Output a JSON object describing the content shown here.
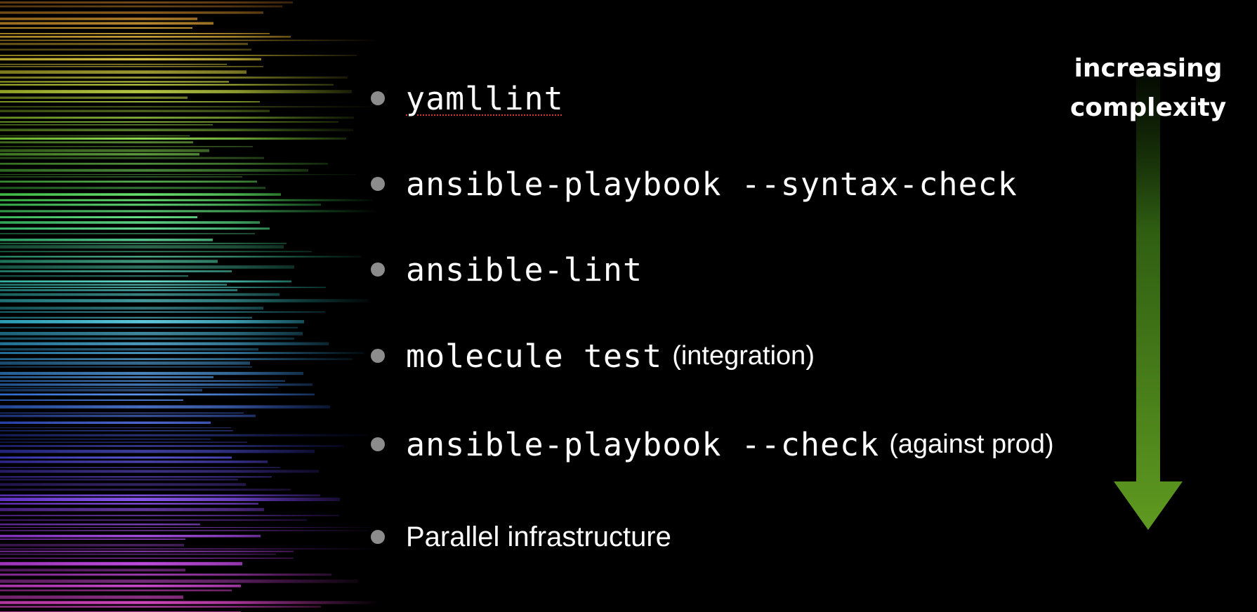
{
  "slide": {
    "background": "#000000",
    "items": [
      {
        "code": "yamllint",
        "note": ""
      },
      {
        "code": "ansible-playbook --syntax-check",
        "note": ""
      },
      {
        "code": "ansible-lint",
        "note": ""
      },
      {
        "code": "molecule test",
        "note": "(integration)"
      },
      {
        "code": "ansible-playbook --check",
        "note": "(against prod)"
      },
      {
        "text": "Parallel infrastructure"
      }
    ],
    "complexity_label": {
      "line1": "increasing",
      "line2": "complexity"
    },
    "arrow": {
      "icon": "down-arrow-icon",
      "color": "#5a8f1e"
    },
    "decoration": {
      "icon": "rainbow-spectrum-streaks",
      "colors": [
        "#ff9a2e",
        "#f5e13a",
        "#9be22d",
        "#3fe24a",
        "#2ce0a0",
        "#27d3f0",
        "#2b8cf5",
        "#2f3ef2",
        "#7a3cf0",
        "#c040f0",
        "#ff4fd8"
      ]
    }
  }
}
